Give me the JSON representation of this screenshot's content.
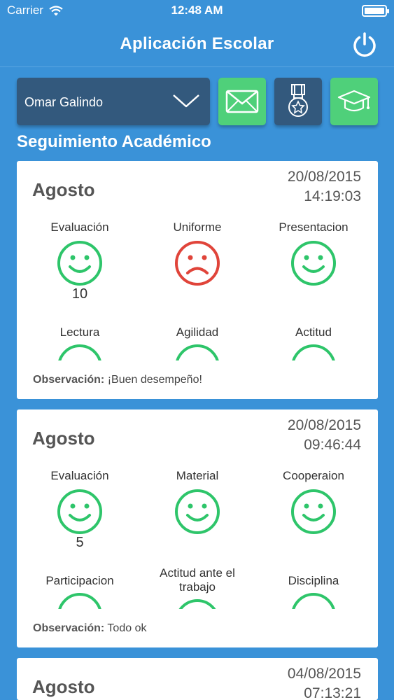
{
  "status_bar": {
    "carrier": "Carrier",
    "time": "12:48 AM"
  },
  "nav": {
    "title": "Aplicación Escolar",
    "power_icon": "power-icon"
  },
  "toolbar": {
    "student_name": "Omar Galindo",
    "buttons": [
      {
        "icon": "mail-icon",
        "color": "#4fd07a"
      },
      {
        "icon": "medal-icon",
        "color": "#33597d"
      },
      {
        "icon": "graduation-cap-icon",
        "color": "#4fd07a"
      }
    ]
  },
  "section_title": "Seguimiento Académico",
  "colors": {
    "happy": "#2ec56a",
    "sad": "#e0443a",
    "background": "#3a92d8",
    "dropdown": "#33597d"
  },
  "cards": [
    {
      "month": "Agosto",
      "date": "20/08/2015",
      "time": "14:19:03",
      "metrics_row1": [
        {
          "label": "Evaluación",
          "face": "happy",
          "score": "10"
        },
        {
          "label": "Uniforme",
          "face": "sad",
          "score": ""
        },
        {
          "label": "Presentacion",
          "face": "happy",
          "score": ""
        }
      ],
      "metrics_row2": [
        {
          "label": "Lectura",
          "face": "happy"
        },
        {
          "label": "Agilidad",
          "face": "happy"
        },
        {
          "label": "Actitud",
          "face": "happy"
        }
      ],
      "observation_label": "Observación:",
      "observation_text": "¡Buen desempeño!"
    },
    {
      "month": "Agosto",
      "date": "20/08/2015",
      "time": "09:46:44",
      "metrics_row1": [
        {
          "label": "Evaluación",
          "face": "happy",
          "score": "5"
        },
        {
          "label": "Material",
          "face": "happy",
          "score": ""
        },
        {
          "label": "Cooperaion",
          "face": "happy",
          "score": ""
        }
      ],
      "metrics_row2": [
        {
          "label": "Participacion",
          "face": "happy"
        },
        {
          "label": "Actitud ante el trabajo",
          "face": "happy"
        },
        {
          "label": "Disciplina",
          "face": "happy"
        }
      ],
      "observation_label": "Observación:",
      "observation_text": "Todo ok"
    },
    {
      "month": "Agosto",
      "date": "04/08/2015",
      "time": "07:13:21"
    }
  ]
}
